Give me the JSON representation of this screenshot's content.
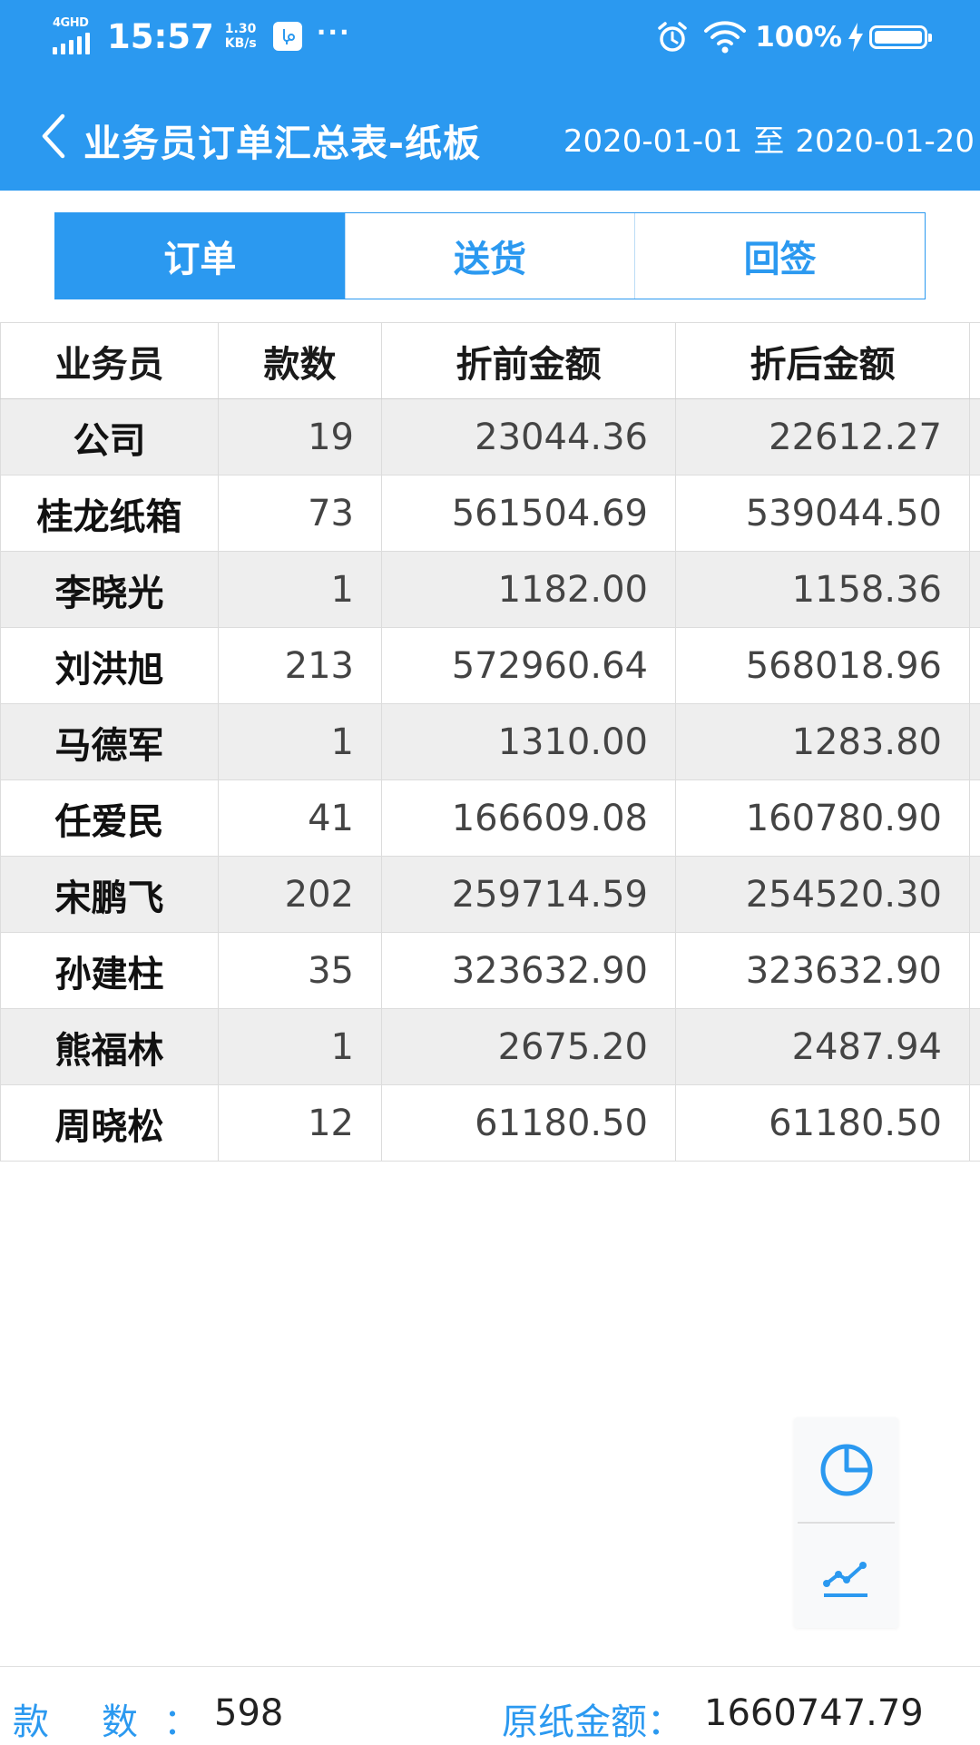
{
  "status_bar": {
    "network": "4GHD",
    "time": "15:57",
    "speed_value": "1.30",
    "speed_unit": "KB/s",
    "more": "···",
    "battery": "100%"
  },
  "nav": {
    "title": "业务员订单汇总表-纸板",
    "date_from": "2020-01-01",
    "date_sep": "至",
    "date_to": "2020-01-20"
  },
  "tabs": [
    {
      "label": "订单",
      "active": true
    },
    {
      "label": "送货",
      "active": false
    },
    {
      "label": "回签",
      "active": false
    }
  ],
  "table": {
    "headers": [
      "业务员",
      "款数",
      "折前金额",
      "折后金额"
    ],
    "rows": [
      {
        "name": "公司",
        "count": "19",
        "before": "23044.36",
        "after": "22612.27"
      },
      {
        "name": "桂龙纸箱",
        "count": "73",
        "before": "561504.69",
        "after": "539044.50"
      },
      {
        "name": "李晓光",
        "count": "1",
        "before": "1182.00",
        "after": "1158.36"
      },
      {
        "name": "刘洪旭",
        "count": "213",
        "before": "572960.64",
        "after": "568018.96"
      },
      {
        "name": "马德军",
        "count": "1",
        "before": "1310.00",
        "after": "1283.80"
      },
      {
        "name": "任爱民",
        "count": "41",
        "before": "166609.08",
        "after": "160780.90"
      },
      {
        "name": "宋鹏飞",
        "count": "202",
        "before": "259714.59",
        "after": "254520.30"
      },
      {
        "name": "孙建柱",
        "count": "35",
        "before": "323632.90",
        "after": "323632.90"
      },
      {
        "name": "熊福林",
        "count": "1",
        "before": "2675.20",
        "after": "2487.94"
      },
      {
        "name": "周晓松",
        "count": "12",
        "before": "61180.50",
        "after": "61180.50"
      }
    ]
  },
  "fab": {
    "pie_icon": "pie-chart-icon",
    "line_icon": "line-chart-icon"
  },
  "footer": {
    "count_label": "款数",
    "colon": "：",
    "count_value": "598",
    "amount_label": "原纸金额：",
    "amount_value": "1660747.79"
  },
  "colors": {
    "primary": "#2b99f0",
    "row_alt": "#eeeeee"
  }
}
